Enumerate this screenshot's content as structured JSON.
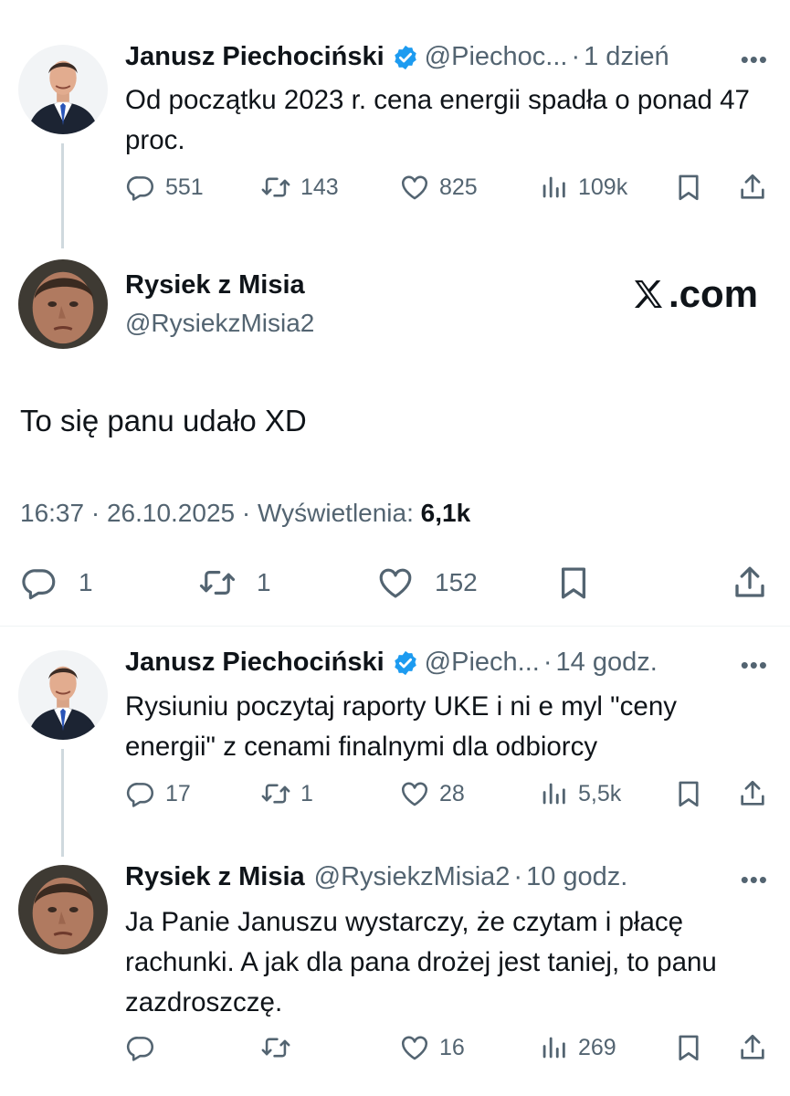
{
  "tweet1": {
    "name": "Janusz Piechociński",
    "handle": "@Piechoc...",
    "sep": "·",
    "time": "1 dzień",
    "more": "•••",
    "text": "Od początku 2023 r. cena energii spadła o ponad 47 proc.",
    "replies": "551",
    "retweets": "143",
    "likes": "825",
    "views": "109k"
  },
  "main": {
    "name": "Rysiek z Misia",
    "handle": "@RysiekzMisia2",
    "watermark": ".com",
    "text": "To się panu udało XD",
    "timestamp": "16:37 · 26.10.2025 · Wyświetlenia:",
    "views": "6,1k",
    "replies": "1",
    "retweets": "1",
    "likes": "152"
  },
  "tweet2": {
    "name": "Janusz Piechociński",
    "handle": "@Piech...",
    "sep": "·",
    "time": "14 godz.",
    "more": "•••",
    "text": "Rysiuniu poczytaj raporty UKE i ni e myl \"ceny energii\" z cenami finalnymi dla odbiorcy",
    "replies": "17",
    "retweets": "1",
    "likes": "28",
    "views": "5,5k"
  },
  "tweet3": {
    "name": "Rysiek z Misia",
    "handle": "@RysiekzMisia2",
    "sep": "·",
    "time": "10 godz.",
    "more": "•••",
    "text": "Ja Panie Januszu wystarczy, że czytam i płacę rachunki. A jak dla pana drożej jest taniej, to panu zazdroszczę.",
    "likes": "16",
    "views": "269"
  },
  "colors": {
    "text": "#0f1419",
    "muted": "#536471",
    "verified": "#1d9bf0",
    "thread_line": "#cfd9de"
  },
  "icons": [
    "reply-icon",
    "retweet-icon",
    "like-icon",
    "views-icon",
    "bookmark-icon",
    "share-icon",
    "verified-badge-icon",
    "x-logo-icon",
    "more-icon"
  ]
}
